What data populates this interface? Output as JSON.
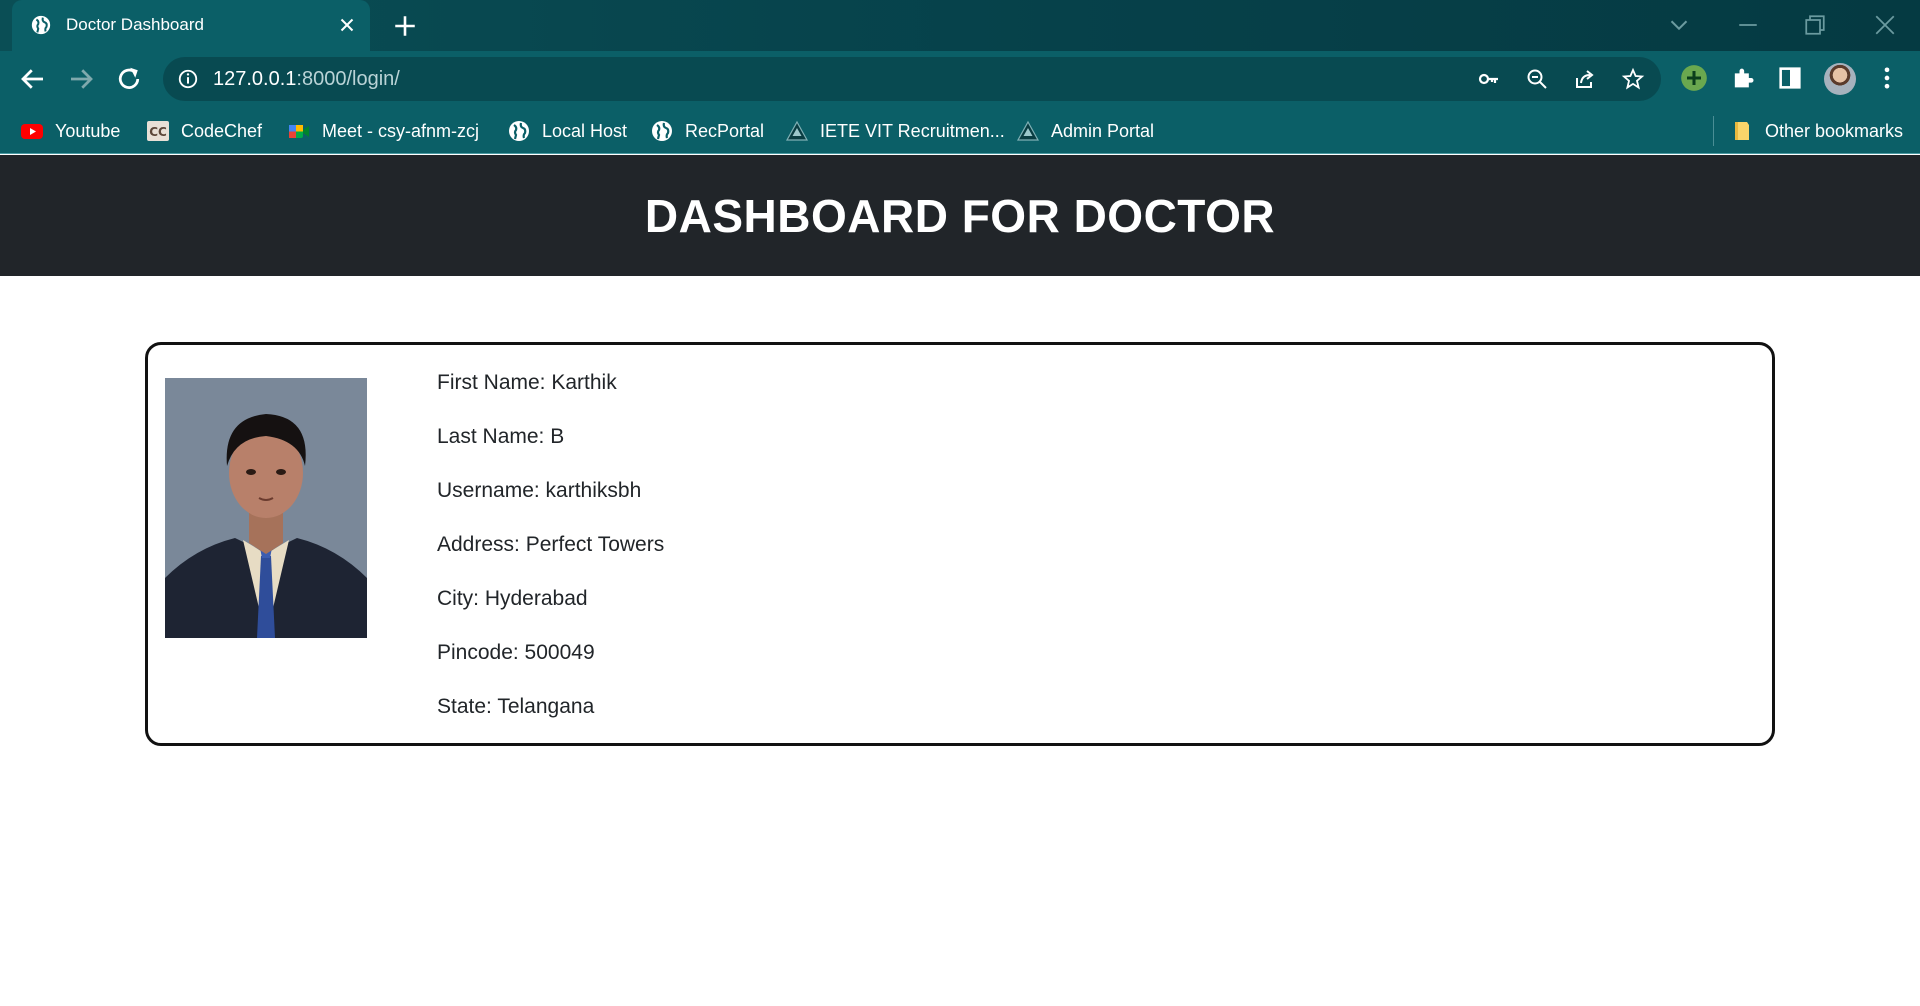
{
  "browser": {
    "tab_title": "Doctor Dashboard",
    "url_host": "127.0.0.1",
    "url_path": ":8000/login/",
    "bookmarks": [
      {
        "label": "Youtube",
        "icon": "youtube-icon"
      },
      {
        "label": "CodeChef",
        "icon": "codechef-icon"
      },
      {
        "label": "Meet - csy-afnm-zcj",
        "icon": "google-meet-icon"
      },
      {
        "label": "Local Host",
        "icon": "globe-icon"
      },
      {
        "label": "RecPortal",
        "icon": "globe-icon"
      },
      {
        "label": "IETE VIT Recruitmen...",
        "icon": "iete-logo-icon"
      },
      {
        "label": "Admin Portal",
        "icon": "iete-logo-icon"
      }
    ],
    "other_bookmarks": "Other bookmarks"
  },
  "page": {
    "title": "DASHBOARD FOR DOCTOR"
  },
  "profile": {
    "first_name": "First Name: Karthik",
    "last_name": "Last Name: B",
    "username": "Username: karthiksbh",
    "address": "Address: Perfect Towers",
    "city": "City: Hyderabad",
    "pincode": "Pincode: 500049",
    "state": "State: Telangana"
  },
  "colors": {
    "chrome_dark": "#053a42",
    "chrome_tab": "#0b5f67",
    "header_bg": "#212529",
    "card_border": "#111111"
  }
}
